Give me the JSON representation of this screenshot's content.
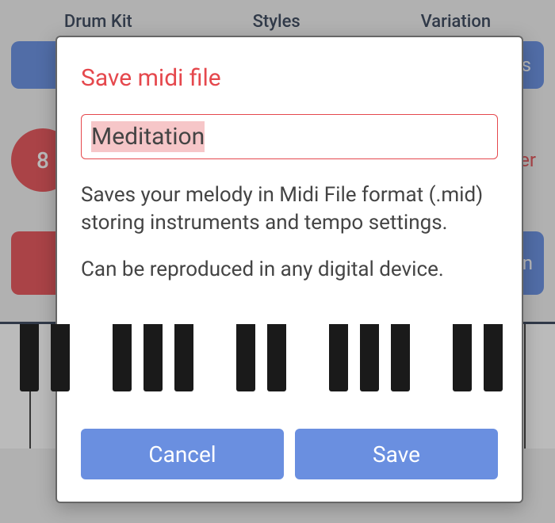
{
  "background": {
    "tabs": [
      "Drum Kit",
      "Styles",
      "Variation"
    ],
    "right_btn_fragment": "rs",
    "badge_fragment": "8",
    "right_panel_fragment": "er",
    "ctrl_right_fragment": "n"
  },
  "modal": {
    "title": "Save midi file",
    "filename": "Meditation",
    "description_p1": "Saves your melody in Midi File format (.mid) storing instruments and tempo settings.",
    "description_p2": "Can be reproduced in any digital device.",
    "cancel_label": "Cancel",
    "save_label": "Save"
  }
}
